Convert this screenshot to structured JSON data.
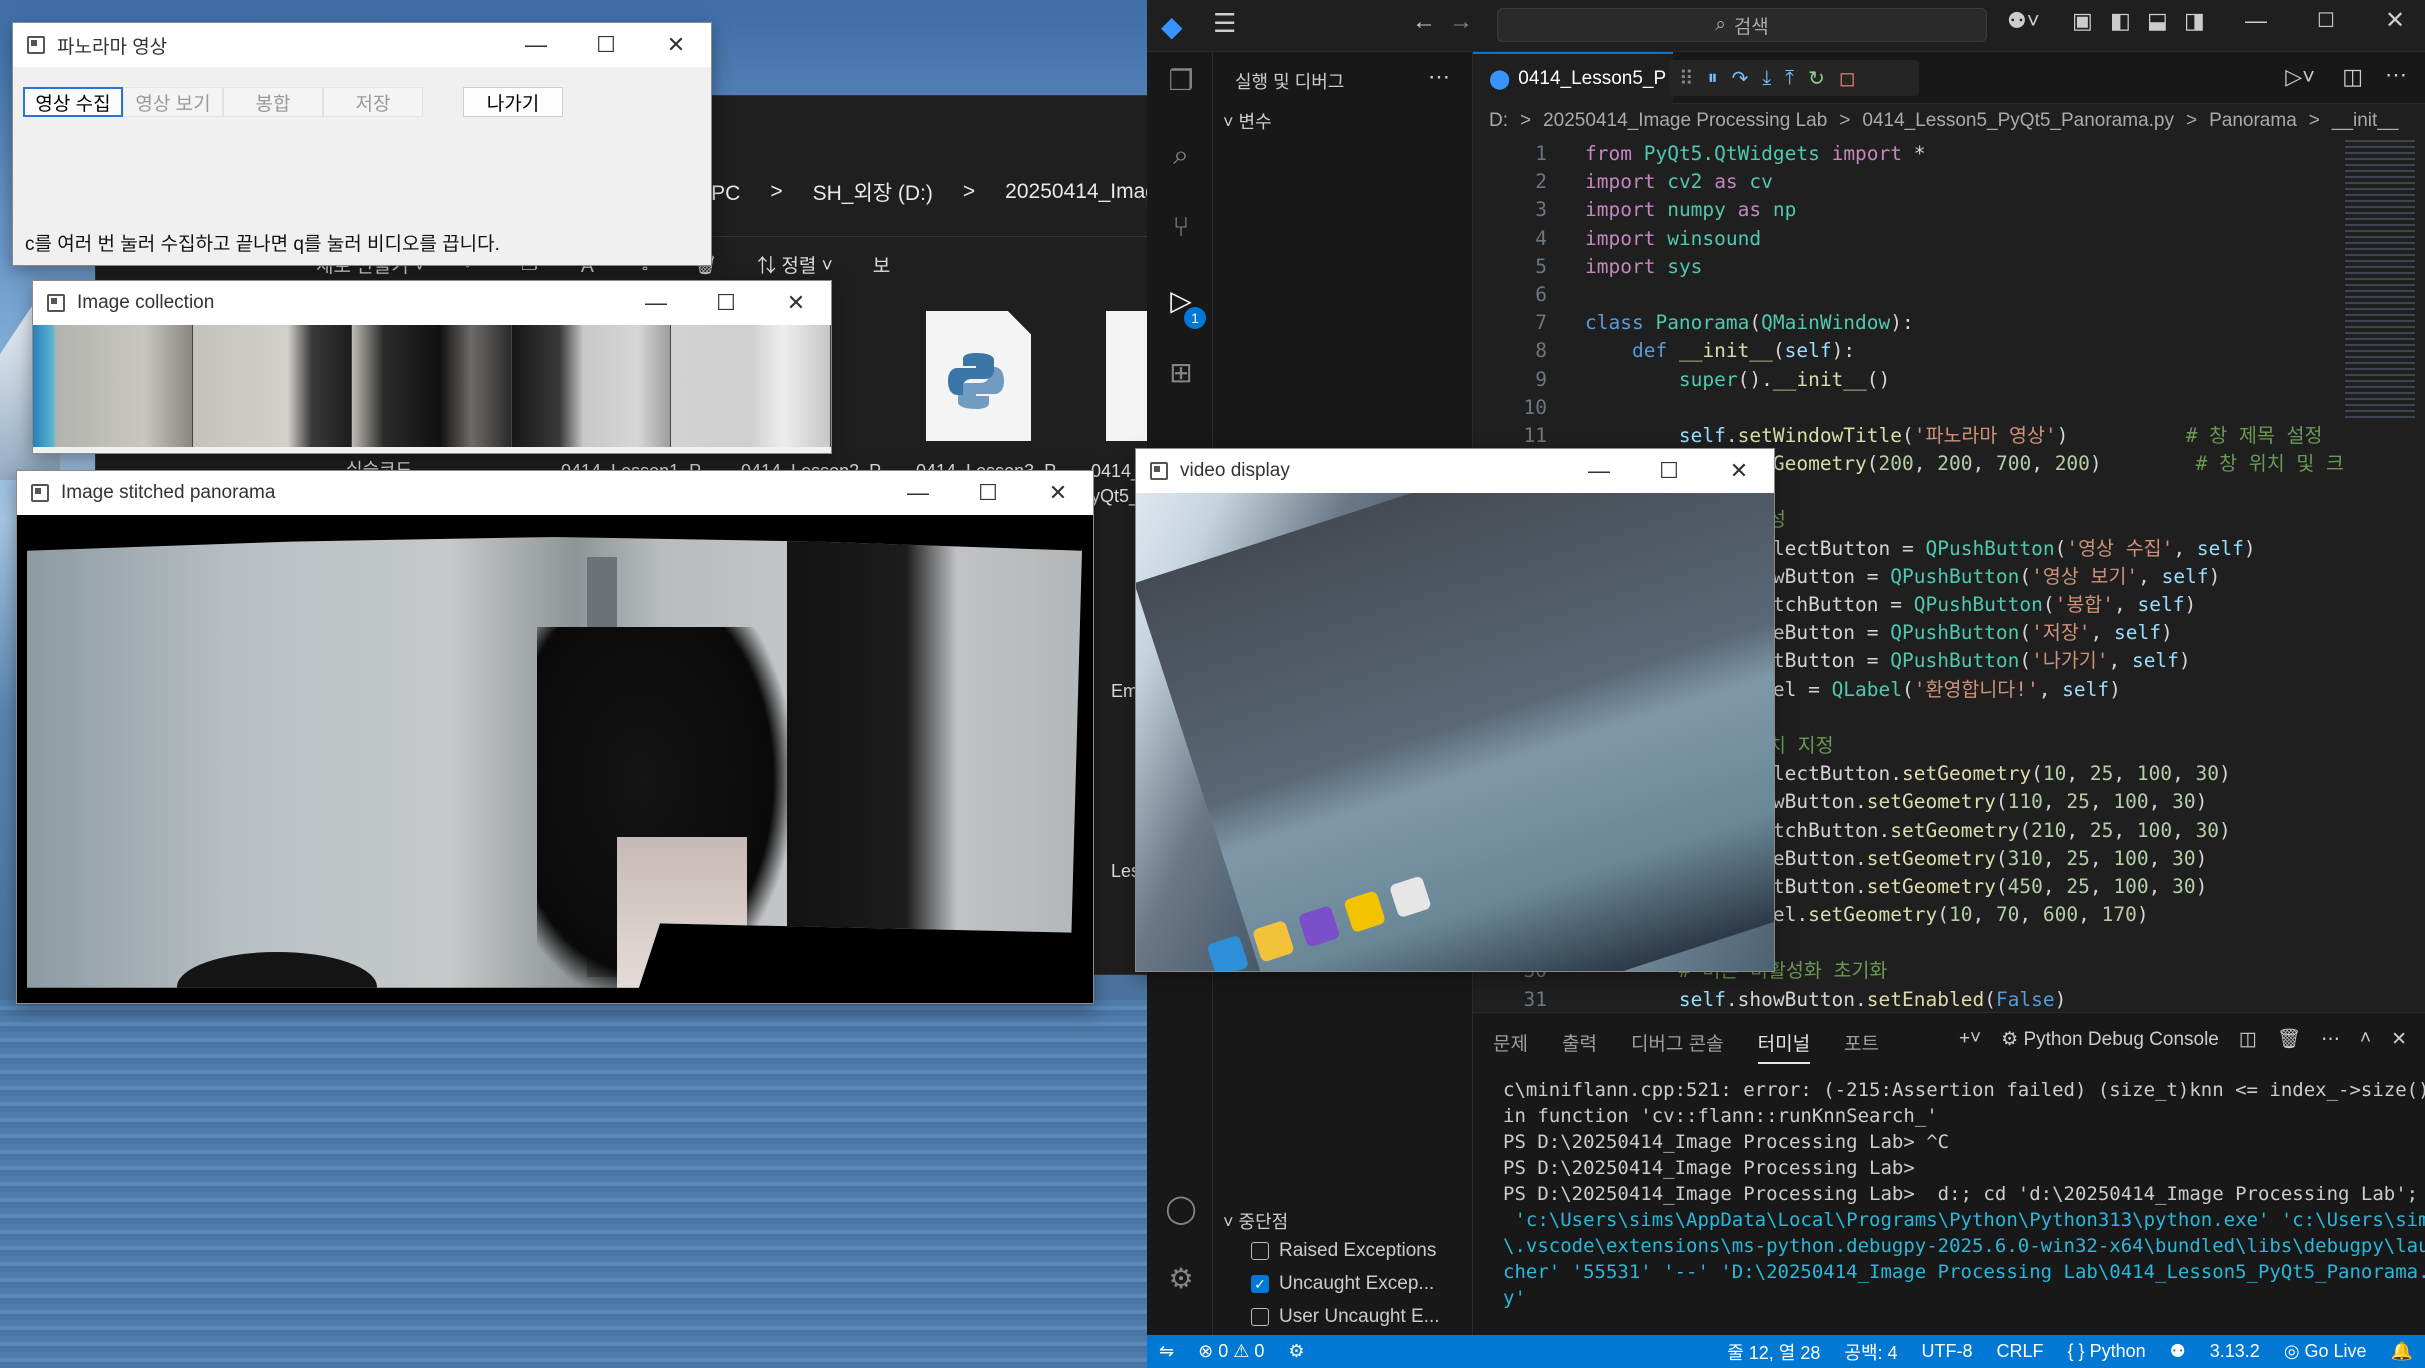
{
  "explorer": {
    "breadcrumb": [
      "내 PC",
      ">",
      "SH_외장 (D:)",
      ">",
      "20250414_Imag"
    ],
    "tools": [
      "새로 만들기 ˅",
      "정렬 ˅",
      "보"
    ],
    "files": [
      "0414_Lesson1_P",
      "0414_Lesson2_P",
      "0414_Lesson3_P",
      "0414_"
    ],
    "folder_label": "실습코드",
    "side_labels": [
      "Em",
      "Les",
      "yQt5_"
    ]
  },
  "panorama_app": {
    "title": "파노라마 영상",
    "buttons": [
      "영상 수집",
      "영상 보기",
      "봉합",
      "저장",
      "나가기"
    ],
    "label": "c를 여러 번 눌러 수집하고 끝나면 q를 눌러 비디오를 끕니다."
  },
  "image_collection": {
    "title": "Image collection"
  },
  "stitched": {
    "title": "Image stitched panorama"
  },
  "video": {
    "title": "video display"
  },
  "vscode": {
    "search": "검색",
    "side_title": "실행 및 디버그",
    "variables": "변수",
    "breakpoints": "중단점",
    "bp_items": [
      {
        "label": "Raised Exceptions",
        "checked": false
      },
      {
        "label": "Uncaught Excep...",
        "checked": true
      },
      {
        "label": "User Uncaught E...",
        "checked": false
      }
    ],
    "tab": "0414_Lesson5_P",
    "breadcrumb": [
      "D:",
      ">",
      "20250414_Image Processing Lab",
      ">",
      "0414_Lesson5_PyQt5_Panorama.py",
      ">",
      "Panorama",
      ">",
      "__init__"
    ],
    "panel_tabs": [
      "문제",
      "출력",
      "디버그 콘솔",
      "터미널",
      "포트"
    ],
    "panel_active": "터미널",
    "debug_console": "Python Debug Console",
    "terminal": [
      "c\\miniflann.cpp:521: error: (-215:Assertion failed) (size_t)knn <= index_->size()",
      "in function 'cv::flann::runKnnSearch_'",
      "PS D:\\20250414_Image Processing Lab> ^C",
      "PS D:\\20250414_Image Processing Lab>",
      "PS D:\\20250414_Image Processing Lab>  d:; cd 'd:\\20250414_Image Processing Lab'; &",
      " 'c:\\Users\\sims\\AppData\\Local\\Programs\\Python\\Python313\\python.exe' 'c:\\Users\\sims",
      "\\.vscode\\extensions\\ms-python.debugpy-2025.6.0-win32-x64\\bundled\\libs\\debugpy\\laun",
      "cher' '55531' '--' 'D:\\20250414_Image Processing Lab\\0414_Lesson5_PyQt5_Panorama.p",
      "y'"
    ],
    "status": {
      "errors": "0",
      "warnings": "0",
      "position": "줄 12, 열 28",
      "spaces": "공백: 4",
      "encoding": "UTF-8",
      "eol": "CRLF",
      "language": "{ } Python",
      "version": "3.13.2",
      "golive": "Go Live"
    }
  }
}
